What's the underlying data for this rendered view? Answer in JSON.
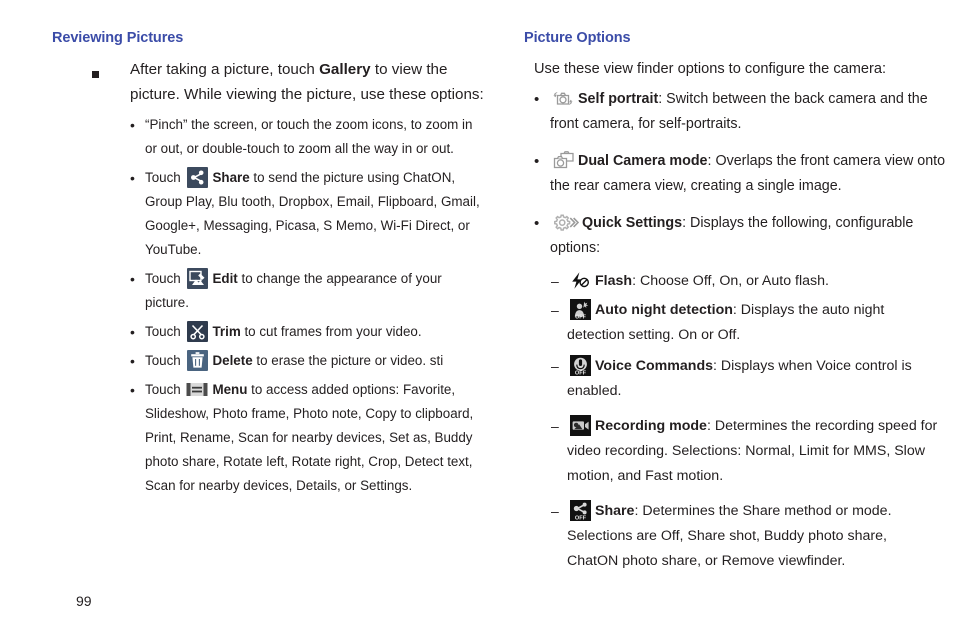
{
  "page": {
    "number": "99",
    "heading_color": "#3b4ca8",
    "text_color": "#231f20"
  },
  "left_column": {
    "heading": "Reviewing Pictures",
    "main_bullet": {
      "text_before": "After taking a picture, touch ",
      "bold": "Gallery",
      "text_after": " to view the picture. While viewing the picture, use these options:"
    },
    "items": [
      {
        "icon": "none",
        "lead": "",
        "bold": "",
        "text": "“Pinch” the screen, or touch the zoom icons, to zoom in or out, or double-touch to zoom all the way in or out."
      },
      {
        "icon": "share-icon",
        "lead": "Touch ",
        "bold": "Share",
        "text": " to send the picture using ChatON, Group Play, Blu  tooth, Dropbox, Email, Flipboard, Gmail, Google+, Messaging, Picasa, S Memo, Wi-Fi Direct, or YouTube."
      },
      {
        "icon": "edit-icon",
        "lead": "Touch ",
        "bold": "Edit",
        "text": " to change the appearance of your picture."
      },
      {
        "icon": "trim-icon",
        "lead": "Touch ",
        "bold": "Trim",
        "text": " to cut frames from your video."
      },
      {
        "icon": "delete-icon",
        "lead": "Touch ",
        "bold": "Delete",
        "text": " to erase the picture or video. sti"
      },
      {
        "icon": "menu-icon",
        "lead": "Touch ",
        "bold": "Menu",
        "text": " to access added options: Favorite, Slideshow, Photo frame, Photo note, Copy to clipboard, Print, Rename, Scan for nearby devices, Set as, Buddy photo share, Rotate left, Rotate right, Crop, Detect text, Scan for nearby devices, Details, or Settings."
      }
    ]
  },
  "right_column": {
    "heading": "Picture Options",
    "intro": "Use these view finder options to configure the camera:",
    "items": [
      {
        "icon": "self-portrait-icon",
        "bold": "Self portrait",
        "text": ": Switch between the back camera and the front camera, for self-portraits."
      },
      {
        "icon": "dual-camera-icon",
        "bold": "Dual Camera mode",
        "text": ": Overlaps the front camera view onto the rear camera view, creating a single image."
      },
      {
        "icon": "quick-settings-icon",
        "bold": "Quick Settings",
        "text": ": Displays the following, configurable options:"
      }
    ],
    "sub_items": [
      {
        "icon": "flash-icon",
        "bold": "Flash",
        "text": ": Choose Off, On, or Auto flash."
      },
      {
        "icon": "auto-night-detection-icon",
        "bold": "Auto night detection",
        "text": ": Displays the auto night detection setting. On or Off."
      },
      {
        "icon": "voice-commands-icon",
        "bold": "Voice Commands",
        "text": ": Displays when Voice control is enabled."
      },
      {
        "icon": "recording-mode-icon",
        "bold": "Recording mode",
        "text": ": Determines the recording speed for video recording. Selections: Normal, Limit for MMS, Slow motion, and Fast motion."
      },
      {
        "icon": "share-mode-icon",
        "bold": "Share",
        "text": ": Determines the Share method or mode. Selections are Off, Share shot, Buddy photo share, ChatON photo share, or Remove viewfinder."
      }
    ]
  }
}
